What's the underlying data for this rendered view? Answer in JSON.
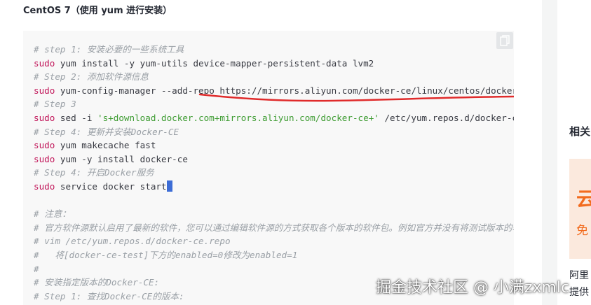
{
  "article": {
    "heading": "CentOS 7（使用 yum 进行安装）"
  },
  "code_block": {
    "copy_icon": "copy-icon",
    "lines": [
      {
        "type": "comment",
        "text": "# step 1: 安装必要的一些系统工具"
      },
      {
        "type": "cmd",
        "kw": "sudo",
        "rest": " yum install -y yum-utils device-mapper-persistent-data lvm2"
      },
      {
        "type": "comment",
        "text": "# Step 2: 添加软件源信息"
      },
      {
        "type": "cmd",
        "kw": "sudo",
        "rest": " yum-config-manager --add-repo https://mirrors.aliyun.com/docker-ce/linux/centos/docker-ce.repo"
      },
      {
        "type": "comment",
        "text": "# Step 3"
      },
      {
        "type": "cmdstr",
        "kw": "sudo",
        "pre": " sed -i ",
        "str": "'s+download.docker.com+mirrors.aliyun.com/docker-ce+'",
        "post": " /etc/yum.repos.d/docker-ce.repo"
      },
      {
        "type": "comment",
        "text": "# Step 4: 更新并安装Docker-CE"
      },
      {
        "type": "cmd",
        "kw": "sudo",
        "rest": " yum makecache fast"
      },
      {
        "type": "cmd",
        "kw": "sudo",
        "rest": " yum -y install docker-ce"
      },
      {
        "type": "comment",
        "text": "# Step 4: 开启Docker服务"
      },
      {
        "type": "cmd",
        "kw": "sudo",
        "rest": " service docker start",
        "cursor": true
      },
      {
        "type": "blank",
        "text": ""
      },
      {
        "type": "comment",
        "text": "# 注意："
      },
      {
        "type": "comment",
        "text": "# 官方软件源默认启用了最新的软件，您可以通过编辑软件源的方式获取各个版本的软件包。例如官方并没有将测试版本的软件源置为可用，"
      },
      {
        "type": "comment",
        "text": "# vim /etc/yum.repos.d/docker-ce.repo"
      },
      {
        "type": "comment",
        "text": "#   将[docker-ce-test]下方的enabled=0修改为enabled=1"
      },
      {
        "type": "comment",
        "text": "#"
      },
      {
        "type": "comment",
        "text": "# 安装指定版本的Docker-CE:"
      },
      {
        "type": "comment",
        "text": "# Step 1: 查找Docker-CE的版本:"
      }
    ]
  },
  "sidebar": {
    "title": "相关",
    "banner_char": "云",
    "banner_sub": "免",
    "text1": "阿里",
    "text2": "提供"
  },
  "watermark": "掘金技术社区 @ 小满zxmlc",
  "colors": {
    "comment": "#9aa0a6",
    "keyword": "#c2185b",
    "string": "#3e9c32",
    "annotation_underline": "#e02b2b"
  }
}
